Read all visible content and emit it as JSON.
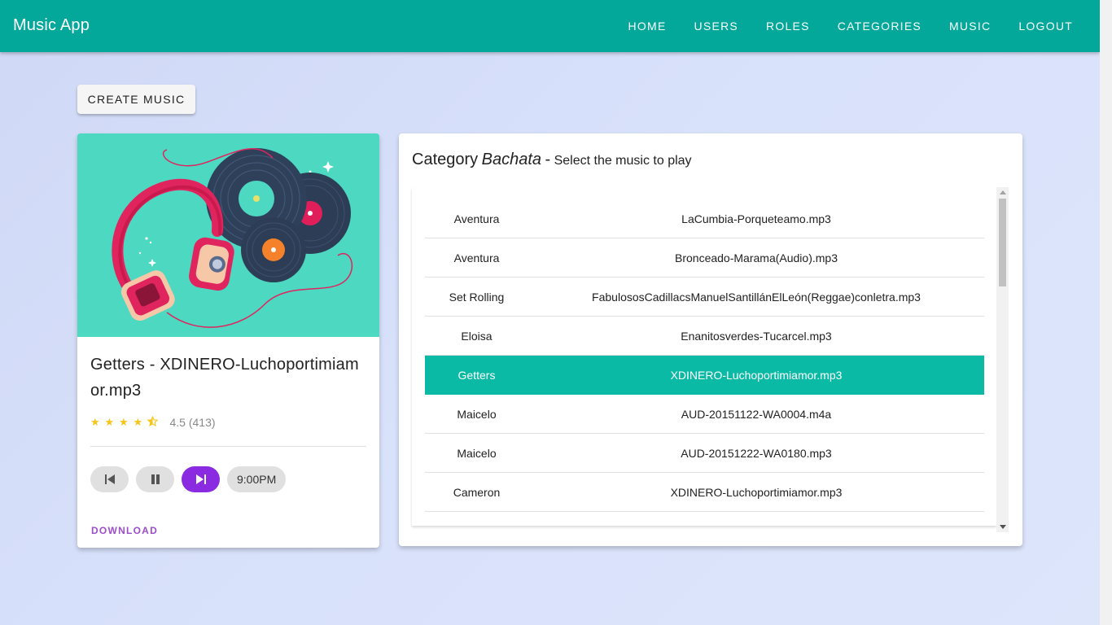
{
  "app": {
    "title": "Music App"
  },
  "nav": {
    "items": [
      "HOME",
      "USERS",
      "ROLES",
      "CATEGORIES",
      "MUSIC",
      "LOGOUT"
    ]
  },
  "create_button": "CREATE MUSIC",
  "player": {
    "title": "Getters - XDINERO-Luchoportimiamor.mp3",
    "rating_value": 4.5,
    "rating_text": "4.5 (413)",
    "time": "9:00PM",
    "download_label": "DOWNLOAD",
    "controls": [
      "skip-previous-icon",
      "pause-icon",
      "skip-next-icon"
    ]
  },
  "list": {
    "heading_prefix": "Category",
    "category_name": "Bachata",
    "heading_dash": "-",
    "heading_suffix": "Select the music to play",
    "rows": [
      {
        "artist": "Aventura",
        "file": "LaCumbia-Porqueteamo.mp3",
        "selected": false
      },
      {
        "artist": "Aventura",
        "file": "Bronceado-Marama(Audio).mp3",
        "selected": false
      },
      {
        "artist": "Set Rolling",
        "file": "FabulososCadillacsManuelSantillánElLeón(Reggae)conletra.mp3",
        "selected": false
      },
      {
        "artist": "Eloisa",
        "file": "Enanitosverdes-Tucarcel.mp3",
        "selected": false
      },
      {
        "artist": "Getters",
        "file": "XDINERO-Luchoportimiamor.mp3",
        "selected": true
      },
      {
        "artist": "Maicelo",
        "file": "AUD-20151122-WA0004.m4a",
        "selected": false
      },
      {
        "artist": "Maicelo",
        "file": "AUD-20151222-WA0180.mp3",
        "selected": false
      },
      {
        "artist": "Cameron",
        "file": "XDINERO-Luchoportimiamor.mp3",
        "selected": false
      }
    ]
  },
  "colors": {
    "appbar": "#03a89a",
    "selected_row": "#0bbaa5",
    "accent_purple": "#8a2be2",
    "download": "#9c4dcc",
    "star": "#f5c518"
  }
}
